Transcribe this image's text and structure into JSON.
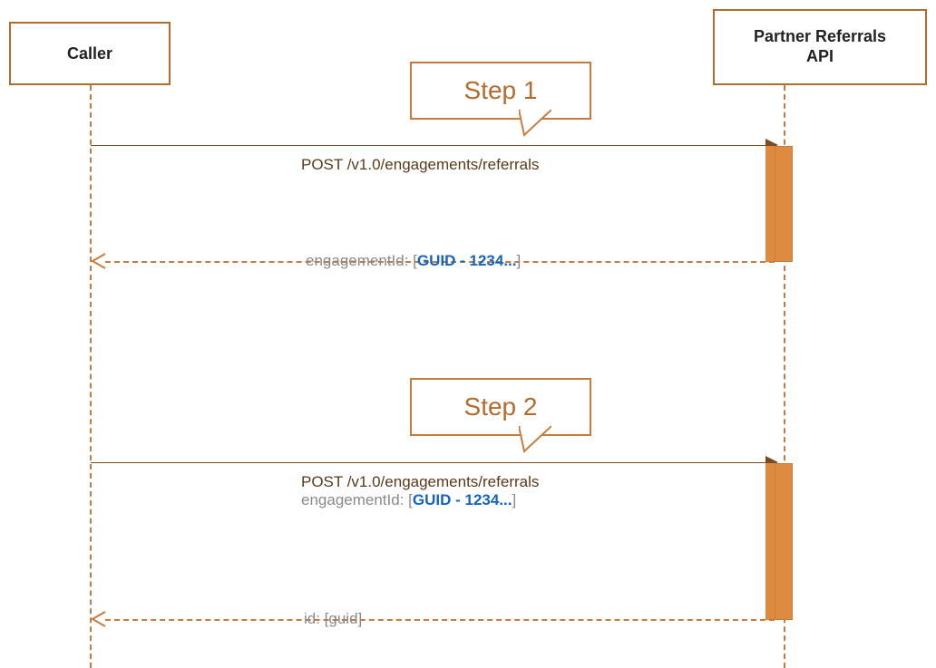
{
  "participants": {
    "caller": "Caller",
    "api_line1": "Partner Referrals",
    "api_line2": "API"
  },
  "callouts": {
    "step1": "Step 1",
    "step2": "Step 2"
  },
  "messages": {
    "step1_request": "POST /v1.0/engagements/referrals",
    "step1_response_key": "engagementId: ",
    "step1_response_bracket_open": "[",
    "step1_response_guid": "GUID - 1234...",
    "step1_response_bracket_close": "]",
    "step2_request": "POST /v1.0/engagements/referrals",
    "step2_request_key": "engagementId: ",
    "step2_request_bracket_open": "[",
    "step2_request_guid": "GUID - 1234...",
    "step2_request_bracket_close": "]",
    "step2_response": "id: [guid]"
  },
  "chart_data": {
    "type": "sequence_diagram",
    "participants": [
      "Caller",
      "Partner Referrals API"
    ],
    "interactions": [
      {
        "step": "Step 1",
        "request": {
          "from": "Caller",
          "to": "Partner Referrals API",
          "message": "POST /v1.0/engagements/referrals",
          "style": "solid"
        },
        "response": {
          "from": "Partner Referrals API",
          "to": "Caller",
          "message": "engagementId: [GUID - 1234...]",
          "style": "dashed"
        }
      },
      {
        "step": "Step 2",
        "request": {
          "from": "Caller",
          "to": "Partner Referrals API",
          "message": "POST /v1.0/engagements/referrals\nengagementId: [GUID - 1234...]",
          "style": "solid"
        },
        "response": {
          "from": "Partner Referrals API",
          "to": "Caller",
          "message": "id: [guid]",
          "style": "dashed"
        }
      }
    ]
  }
}
